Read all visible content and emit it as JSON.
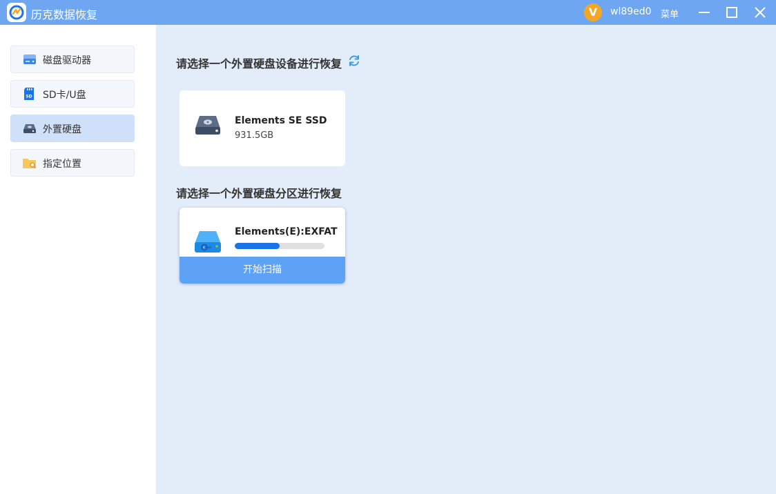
{
  "app": {
    "title": "历克数据恢复"
  },
  "header": {
    "avatar_letter": "V",
    "username": "wl89ed0",
    "menu_label": "菜单"
  },
  "sidebar": {
    "items": [
      {
        "label": "磁盘驱动器",
        "icon": "hard-drive-icon",
        "active": false
      },
      {
        "label": "SD卡/U盘",
        "icon": "sd-card-icon",
        "active": false
      },
      {
        "label": "外置硬盘",
        "icon": "external-drive-icon",
        "active": true
      },
      {
        "label": "指定位置",
        "icon": "folder-search-icon",
        "active": false
      }
    ]
  },
  "main": {
    "device_section_title": "请选择一个外置硬盘设备进行恢复",
    "device": {
      "name": "Elements SE SSD",
      "size": "931.5GB"
    },
    "partition_section_title": "请选择一个外置硬盘分区进行恢复",
    "partition": {
      "name": "Elements(E):EXFAT",
      "usage_fraction": 0.5,
      "scan_label": "开始扫描"
    }
  },
  "colors": {
    "titlebar": "#6fa6f2",
    "accent": "#1a73e8",
    "scan_button": "#5ea2f5",
    "avatar": "#f5a623",
    "active_nav": "#cfe0fa"
  }
}
